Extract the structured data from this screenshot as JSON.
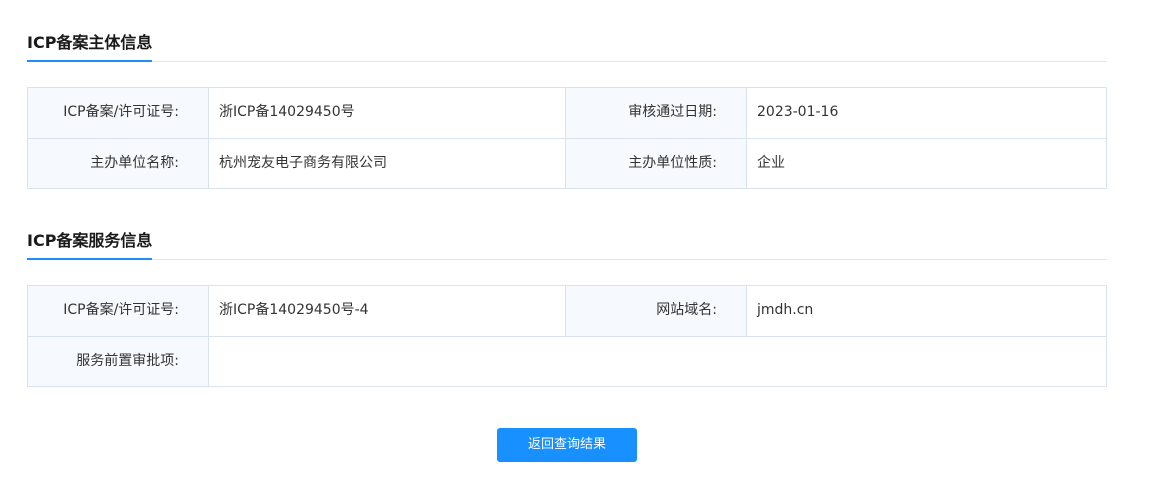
{
  "subject_section": {
    "title": "ICP备案主体信息",
    "rows": [
      {
        "label1": "ICP备案/许可证号:",
        "value1": "浙ICP备14029450号",
        "label2": "审核通过日期:",
        "value2": "2023-01-16"
      },
      {
        "label1": "主办单位名称:",
        "value1": "杭州宠友电子商务有限公司",
        "label2": "主办单位性质:",
        "value2": "企业"
      }
    ]
  },
  "service_section": {
    "title": "ICP备案服务信息",
    "rows": [
      {
        "label1": "ICP备案/许可证号:",
        "value1": "浙ICP备14029450号-4",
        "label2": "网站域名:",
        "value2": "jmdh.cn"
      },
      {
        "label1": "服务前置审批项:",
        "value1": ""
      }
    ]
  },
  "actions": {
    "return_label": "返回查询结果"
  },
  "colors": {
    "accent": "#1890ff",
    "label_bg": "#f6f9fd",
    "border": "#d8e3ee"
  }
}
